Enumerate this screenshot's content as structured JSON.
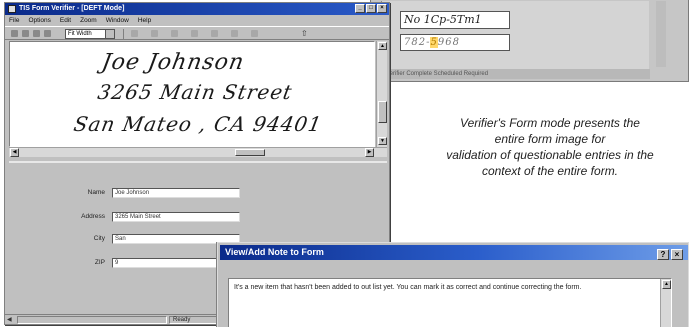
{
  "background_window": {
    "snippet_value": "No 1Cp-5Tm1",
    "snippet_value2_pre": "782-",
    "snippet_value2_hl": "5",
    "snippet_value2_post": "968",
    "status_text": "Verifier Complete Scheduled Required"
  },
  "main_window": {
    "title": "TIS Form Verifier - [DEFT Mode]",
    "title_buttons": [
      "_",
      "□",
      "×"
    ],
    "menu": [
      "File",
      "Options",
      "Edit",
      "Zoom",
      "Window",
      "Help"
    ],
    "toolbar": {
      "zoom_value": "Fit Width"
    },
    "handwriting": [
      "Joe  Johnson",
      "3265  Main  Street",
      "San  Mateo ,  CA   94401"
    ],
    "fields": [
      {
        "label": "Name",
        "value": "Joe Johnson"
      },
      {
        "label": "Address",
        "value": "3265 Main Street"
      },
      {
        "label": "City",
        "value": "San"
      },
      {
        "label": "ZIP",
        "value": "9"
      }
    ],
    "status": "Ready"
  },
  "caption": {
    "line1": "Verifier's Form mode presents the",
    "line2": "entire form image for",
    "line3": "validation of questionable entries in the",
    "line4": "context of the entire form."
  },
  "dialog": {
    "title": "View/Add Note to Form",
    "buttons": [
      "?",
      "×"
    ],
    "note": "It's a new item that hasn't been added to out list yet.  You can mark it as correct and continue correcting the form."
  },
  "colors": {
    "titlebar": "#0a2a8a",
    "dialog_titlebar_end": "#6e9de8",
    "highlight": "#ffd76a"
  }
}
